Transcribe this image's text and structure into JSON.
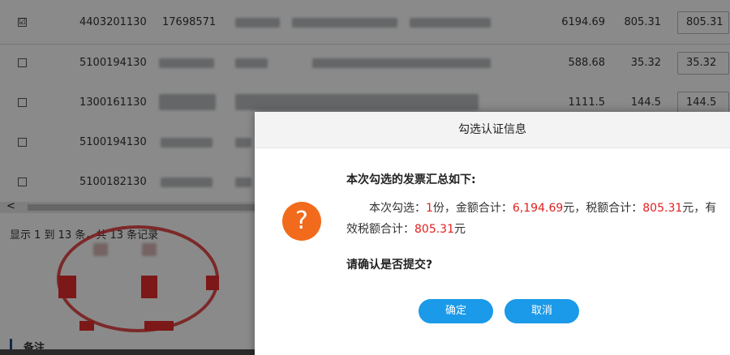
{
  "table": {
    "rows": [
      {
        "checked": true,
        "check_glyph": "☑",
        "code": "4403201130",
        "number": "17698571",
        "amount": "6194.69",
        "tax": "805.31",
        "tax_input": "805.31"
      },
      {
        "checked": false,
        "check_glyph": "☐",
        "code": "5100194130",
        "number": "",
        "amount": "588.68",
        "tax": "35.32",
        "tax_input": "35.32"
      },
      {
        "checked": false,
        "check_glyph": "☐",
        "code": "1300161130",
        "number": "",
        "amount": "1111.5",
        "tax": "144.5",
        "tax_input": "144.5"
      },
      {
        "checked": false,
        "check_glyph": "☐",
        "code": "5100194130",
        "number": "",
        "amount": "",
        "tax": "",
        "tax_input": ""
      },
      {
        "checked": false,
        "check_glyph": "☐",
        "code": "5100182130",
        "number": "",
        "amount": "",
        "tax": "",
        "tax_input": ""
      }
    ],
    "scroll_left_arrow": "<"
  },
  "pagination": {
    "summary": "显示 1 到 13 条，共 13 条记录"
  },
  "remark": {
    "label": "备注"
  },
  "dialog": {
    "title": "勾选认证信息",
    "heading": "本次勾选的发票汇总如下:",
    "line_prefix": "本次勾选：",
    "count": "1",
    "count_unit": "份，金额合计：",
    "amount_total": "6,194.69",
    "amount_unit": "元，税额合计：",
    "tax_total": "805.31",
    "tax_unit": "元，有效税额合计：",
    "valid_tax_total": "805.31",
    "valid_unit": "元",
    "confirm_question": "请确认是否提交?",
    "ok_label": "确定",
    "cancel_label": "取消",
    "icon": "question-icon",
    "icon_glyph": "?"
  },
  "colors": {
    "accent": "#1a9ae8",
    "warning": "#f26b1d",
    "highlight": "#e02020",
    "stamp": "#e23a3a"
  }
}
